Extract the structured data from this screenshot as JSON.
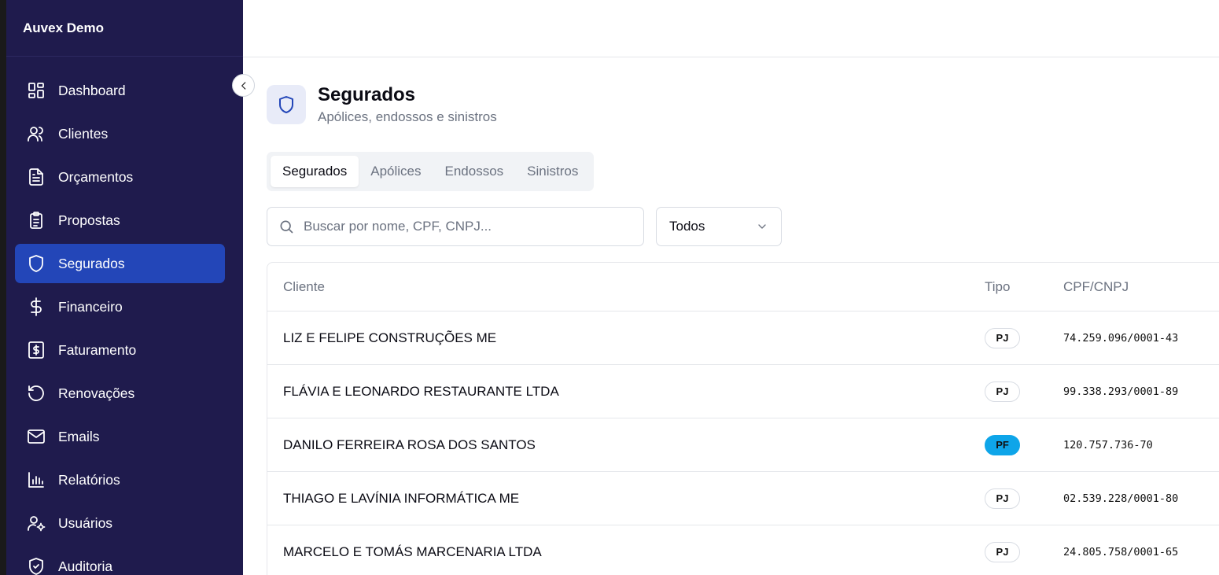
{
  "app": {
    "brand": "Auvex Demo"
  },
  "sidebar": {
    "items": [
      {
        "label": "Dashboard",
        "icon": "dashboard-icon",
        "active": false
      },
      {
        "label": "Clientes",
        "icon": "users-icon",
        "active": false
      },
      {
        "label": "Orçamentos",
        "icon": "document-icon",
        "active": false
      },
      {
        "label": "Propostas",
        "icon": "clipboard-icon",
        "active": false
      },
      {
        "label": "Segurados",
        "icon": "shield-icon",
        "active": true
      },
      {
        "label": "Financeiro",
        "icon": "dollar-icon",
        "active": false
      },
      {
        "label": "Faturamento",
        "icon": "receipt-icon",
        "active": false
      },
      {
        "label": "Renovações",
        "icon": "refresh-icon",
        "active": false
      },
      {
        "label": "Emails",
        "icon": "mail-icon",
        "active": false
      },
      {
        "label": "Relatórios",
        "icon": "bar-chart-icon",
        "active": false
      },
      {
        "label": "Usuários",
        "icon": "user-settings-icon",
        "active": false
      },
      {
        "label": "Auditoria",
        "icon": "shield-check-icon",
        "active": false
      }
    ]
  },
  "page": {
    "title": "Segurados",
    "subtitle": "Apólices, endossos e sinistros",
    "icon": "shield-icon"
  },
  "tabs": [
    {
      "label": "Segurados",
      "active": true
    },
    {
      "label": "Apólices",
      "active": false
    },
    {
      "label": "Endossos",
      "active": false
    },
    {
      "label": "Sinistros",
      "active": false
    }
  ],
  "search": {
    "placeholder": "Buscar por nome, CPF, CNPJ...",
    "value": ""
  },
  "filter": {
    "selected": "Todos"
  },
  "table": {
    "headers": {
      "cliente": "Cliente",
      "tipo": "Tipo",
      "doc": "CPF/CNPJ"
    },
    "rows": [
      {
        "cliente": "LIZ E FELIPE CONSTRUÇÕES ME",
        "tipo": "PJ",
        "doc": "74.259.096/0001-43"
      },
      {
        "cliente": "FLÁVIA E LEONARDO RESTAURANTE LTDA",
        "tipo": "PJ",
        "doc": "99.338.293/0001-89"
      },
      {
        "cliente": "DANILO FERREIRA ROSA DOS SANTOS",
        "tipo": "PF",
        "doc": "120.757.736-70"
      },
      {
        "cliente": "THIAGO E LAVÍNIA INFORMÁTICA ME",
        "tipo": "PJ",
        "doc": "02.539.228/0001-80"
      },
      {
        "cliente": "MARCELO E TOMÁS MARCENARIA LTDA",
        "tipo": "PJ",
        "doc": "24.805.758/0001-65"
      }
    ]
  },
  "colors": {
    "sidebar_bg": "#1f1b4d",
    "active_bg": "#2346b8",
    "pf_badge": "#0ea5e9"
  }
}
